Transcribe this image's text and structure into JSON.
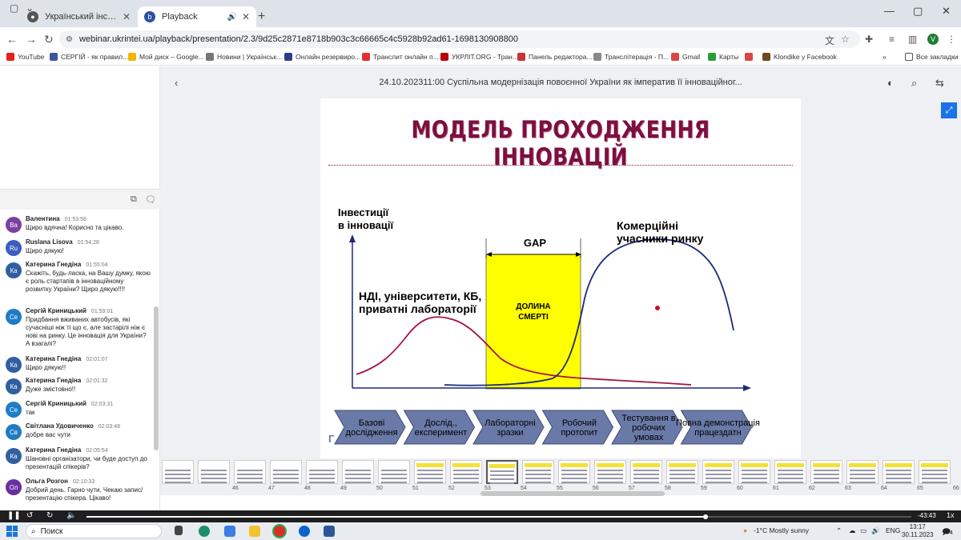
{
  "tabs": [
    {
      "title": "Український інститут науково",
      "active": false
    },
    {
      "title": "Playback",
      "active": true
    }
  ],
  "address": "webinar.ukrintei.ua/playback/presentation/2.3/9d25c2871e8718b903c3c66665c4c5928b92ad61-1698130908800",
  "profile_initial": "V",
  "bookmarks": [
    {
      "label": "YouTube",
      "color": "#e62117"
    },
    {
      "label": "СЕРГІЙ - як правил...",
      "color": "#3b5998"
    },
    {
      "label": "Мой диск – Google...",
      "color": "#f4b400"
    },
    {
      "label": "Новини | Українськ...",
      "color": "#777777"
    },
    {
      "label": "Онлайн резервиро...",
      "color": "#2b3e8c"
    },
    {
      "label": "Транслит онлайн п...",
      "color": "#d33"
    },
    {
      "label": "УКРЛІТ.ORG - Тран...",
      "color": "#b00"
    },
    {
      "label": "Панель редактора...",
      "color": "#c33"
    },
    {
      "label": "Транслітерація - П...",
      "color": "#888"
    },
    {
      "label": "Gmail",
      "color": "#d44"
    },
    {
      "label": "Карты",
      "color": "#2a9d3a"
    },
    {
      "label": "",
      "color": "#d44"
    },
    {
      "label": "Klondike у Facebook",
      "color": "#6b4a1c"
    }
  ],
  "bookmarks_more": "»",
  "all_bookmarks": "Все закладки",
  "messages": [
    {
      "initials": "Ва",
      "color": "#7b3fa0",
      "name": "Валентина",
      "time": "01:53:58",
      "text": "Щиро вдячна! Корисно та цікаво."
    },
    {
      "initials": "Ru",
      "color": "#3a5dbf",
      "name": "Ruslana Lisova",
      "time": "01:54:28",
      "text": "Щиро дякую!"
    },
    {
      "initials": "Ка",
      "color": "#2f5fa0",
      "name": "Катерина Гнедіна",
      "time": "01:55:04",
      "text": "Скажіть, будь-ласка, на Вашу думку, якою є роль стартапів в інноваційному розвитку України? Щиро дякую!!!!"
    },
    {
      "initials": "Се",
      "color": "#1f7bc4",
      "name": "Сергій Криницький",
      "time": "01:59:01",
      "text": "Придбання вживаних автобусів, які сучасніші ніж ті що є, але застарілі ніж є нові на ринку. Це інновація для України? А взагалі?"
    },
    {
      "initials": "Ка",
      "color": "#2f5fa0",
      "name": "Катерина Гнедіна",
      "time": "02:01:07",
      "text": "Щиро дякую!!"
    },
    {
      "initials": "Ка",
      "color": "#2f5fa0",
      "name": "Катерина Гнедіна",
      "time": "02:01:32",
      "text": "Дуже змістовно!!"
    },
    {
      "initials": "Се",
      "color": "#1f7bc4",
      "name": "Сергій Криницький",
      "time": "02:03:31",
      "text": "так"
    },
    {
      "initials": "Св",
      "color": "#1f7bc4",
      "name": "Світлана Удовиченко",
      "time": "02:03:48",
      "text": "добре вас чути"
    },
    {
      "initials": "Ка",
      "color": "#2f5fa0",
      "name": "Катерина Гнедіна",
      "time": "02:05:54",
      "text": "Шановні організатори, чи буде доступ до презентацій спікерів?"
    },
    {
      "initials": "Ол",
      "color": "#6a2fa0",
      "name": "Ольга Розгон",
      "time": "02:10:33",
      "text": "Добрий день. Гарно чути. Чекаю запис/презентацію спікера. Цікаво!"
    }
  ],
  "presentation_title": "24.10.202311:00 Суспільна модернізація повоєнної України як імператив її інноваційног...",
  "slide": {
    "title": "МОДЕЛЬ ПРОХОДЖЕННЯ ІННОВАЦІЙ",
    "y_axis_label": [
      "Інвестиції",
      "в інновації"
    ],
    "gap_label": "GAP",
    "valley_label": [
      "ДОЛИНА",
      "СМЕРТІ"
    ],
    "research_label": [
      "НДІ, університети, КБ,",
      "приватні лабораторії"
    ],
    "market_label": [
      "Комерційні",
      "учасники ринку"
    ],
    "stages": [
      "Базові дослідження",
      "Дослід., експеримент",
      "Лабораторні зразки",
      "Робочий протопит",
      "Тестування в робочих умовах",
      "Повна демонстрація працездатн"
    ],
    "corner_mark": "Г",
    "colors": {
      "title": "#7b1040",
      "valley": "#ffff00",
      "research_curve": "#a5153a",
      "market_curve": "#1a2a7a",
      "stage_arrow": "#6a7aa8"
    }
  },
  "thumbnails": {
    "numbers": [
      "46",
      "47",
      "48",
      "49",
      "50",
      "51",
      "52",
      "53",
      "54",
      "55",
      "56",
      "57",
      "58",
      "59",
      "60",
      "61",
      "62",
      "63",
      "64",
      "65",
      "66"
    ],
    "selected": "54"
  },
  "player": {
    "time": "-43:43",
    "speed": "1x",
    "progress": 0.75
  },
  "taskbar": {
    "search": "Поиск",
    "weather": "-1°C  Mostly sunny",
    "lang": "ENG",
    "time": "13:17",
    "date": "30.11.2023",
    "notifications": "4"
  }
}
